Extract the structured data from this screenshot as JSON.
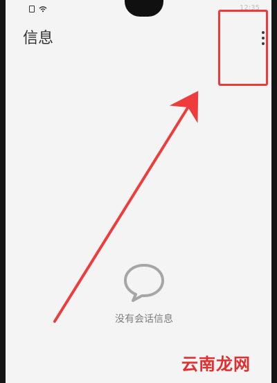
{
  "app": {
    "title": "信息",
    "empty_message": "没有会话信息",
    "watermark": "云南龙网"
  },
  "status_bar": {
    "time_partial": "12:35"
  },
  "accent": {
    "arrow_color": "#ef3b3b",
    "box_color": "#f03a3a"
  },
  "icons": {
    "more": "vertical-more-icon",
    "message": "chat-bubble-icon",
    "sim": "sim-icon",
    "wifi": "wifi-icon"
  }
}
